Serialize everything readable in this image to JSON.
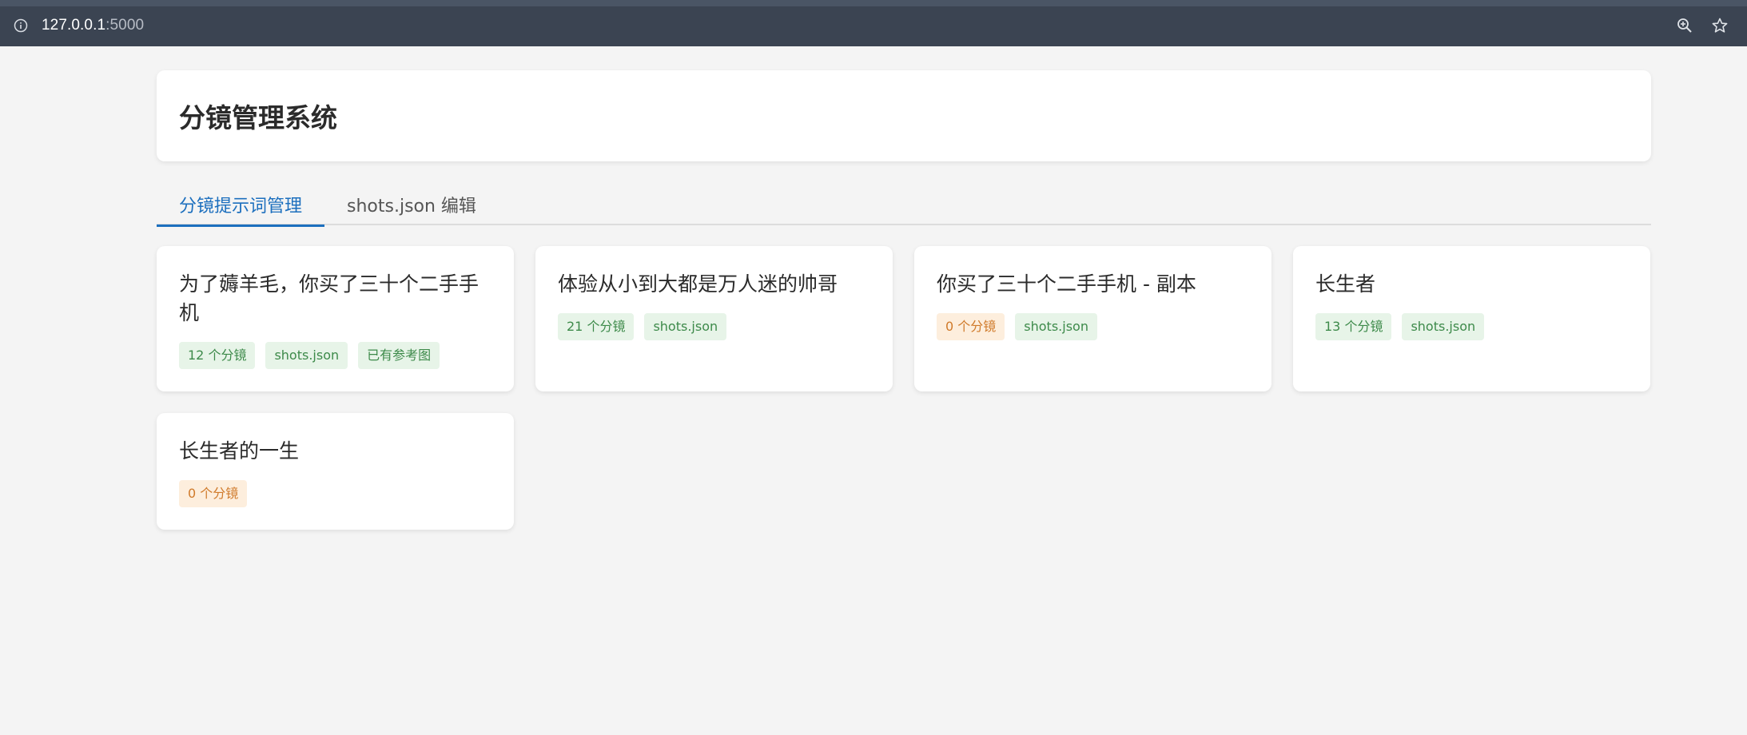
{
  "browser": {
    "url_host": "127.0.0.1",
    "url_port": ":5000",
    "icons": [
      "info-icon",
      "zoom-icon",
      "star-icon"
    ]
  },
  "header": {
    "title": "分镜管理系统"
  },
  "tabs": [
    {
      "label": "分镜提示词管理",
      "active": true
    },
    {
      "label": "shots.json 编辑",
      "active": false
    }
  ],
  "colors": {
    "accent": "#1c6fbe",
    "badge_ok_bg": "#e7f4e8",
    "badge_ok_text": "#3d8a4a",
    "badge_warn_bg": "#fdeedd",
    "badge_warn_text": "#d07a2a"
  },
  "projects": [
    {
      "title": "为了薅羊毛，你买了三十个二手手机",
      "badges": [
        {
          "text": "12 个分镜",
          "type": "ok"
        },
        {
          "text": "shots.json",
          "type": "ok"
        },
        {
          "text": "已有参考图",
          "type": "ok"
        }
      ]
    },
    {
      "title": "体验从小到大都是万人迷的帅哥",
      "badges": [
        {
          "text": "21 个分镜",
          "type": "ok"
        },
        {
          "text": "shots.json",
          "type": "ok"
        }
      ]
    },
    {
      "title": "你买了三十个二手手机 - 副本",
      "badges": [
        {
          "text": "0 个分镜",
          "type": "warn"
        },
        {
          "text": "shots.json",
          "type": "ok"
        }
      ]
    },
    {
      "title": "长生者",
      "badges": [
        {
          "text": "13 个分镜",
          "type": "ok"
        },
        {
          "text": "shots.json",
          "type": "ok"
        }
      ]
    },
    {
      "title": "长生者的一生",
      "badges": [
        {
          "text": "0 个分镜",
          "type": "warn"
        }
      ]
    }
  ]
}
